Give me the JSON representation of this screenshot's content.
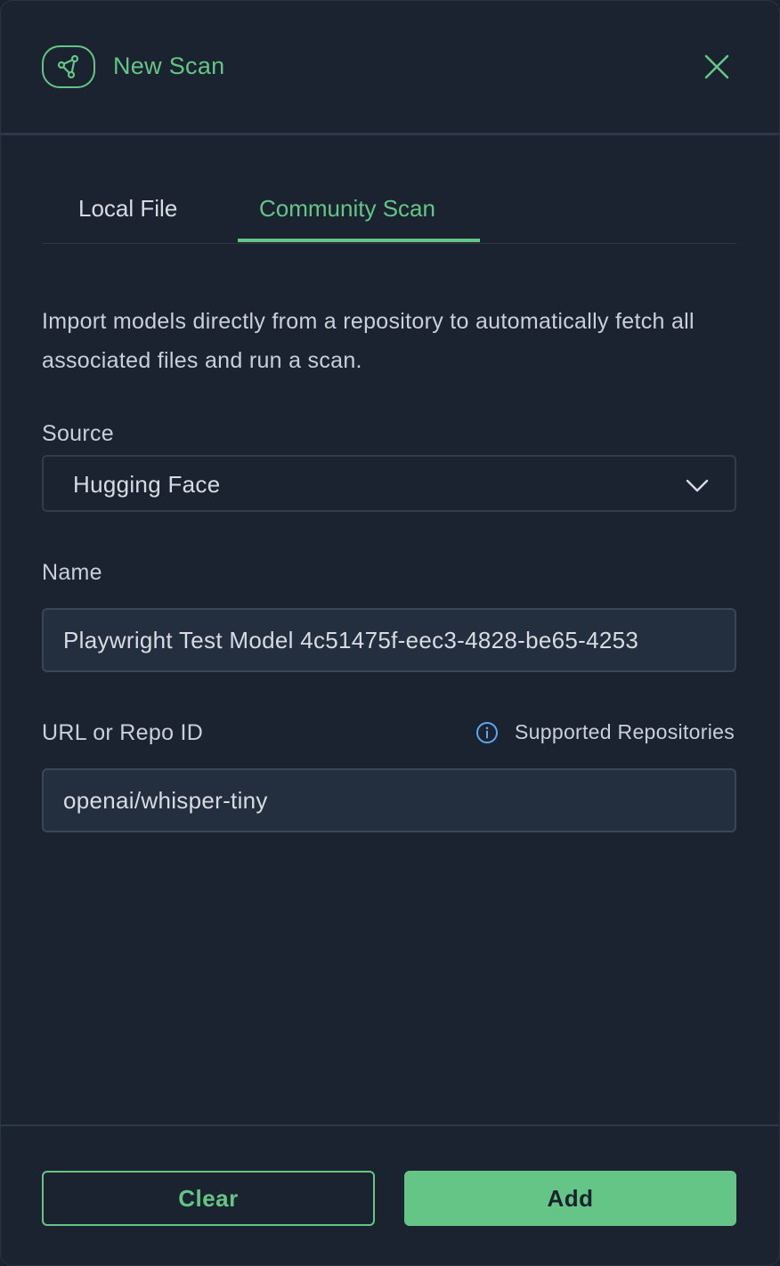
{
  "header": {
    "title": "New Scan",
    "icon": "share-nodes-icon",
    "close_icon": "close-icon"
  },
  "tabs": [
    {
      "label": "Local File",
      "active": false
    },
    {
      "label": "Community Scan",
      "active": true
    }
  ],
  "description": "Import models directly from a repository to automatically fetch all associated files and run a scan.",
  "form": {
    "source": {
      "label": "Source",
      "value": "Hugging Face"
    },
    "name": {
      "label": "Name",
      "value": "Playwright Test Model 4c51475f-eec3-4828-be65-4253"
    },
    "url": {
      "label": "URL or Repo ID",
      "value": "openai/whisper-tiny",
      "help_label": "Supported Repositories",
      "help_icon": "info-icon"
    }
  },
  "footer": {
    "clear_label": "Clear",
    "add_label": "Add"
  },
  "colors": {
    "accent": "#65c587",
    "background": "#1b2330",
    "input_background": "#232e3e",
    "info_icon": "#5aa9f0"
  }
}
